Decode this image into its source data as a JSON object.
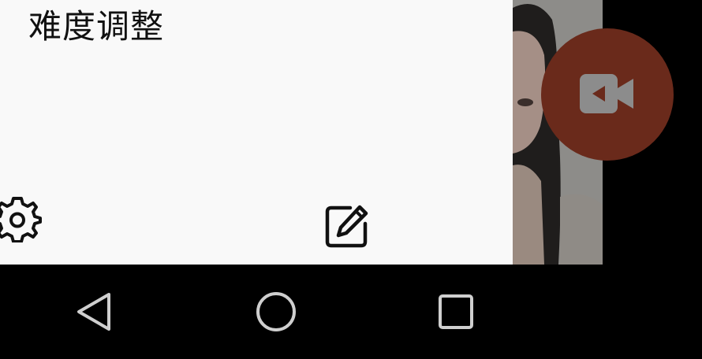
{
  "panel": {
    "title": "难度调整"
  },
  "icons": {
    "settings": "gear-icon",
    "edit": "edit-icon",
    "video_call": "video-camera-icon",
    "nav_back": "triangle-back-icon",
    "nav_home": "circle-home-icon",
    "nav_recent": "square-recent-icon"
  },
  "colors": {
    "panel_bg": "#f9f9f9",
    "fab_bg": "#6a2a1b",
    "fab_icon": "#8c8c8c",
    "navbar_bg": "#000000",
    "nav_icon": "#cfcfcf"
  }
}
